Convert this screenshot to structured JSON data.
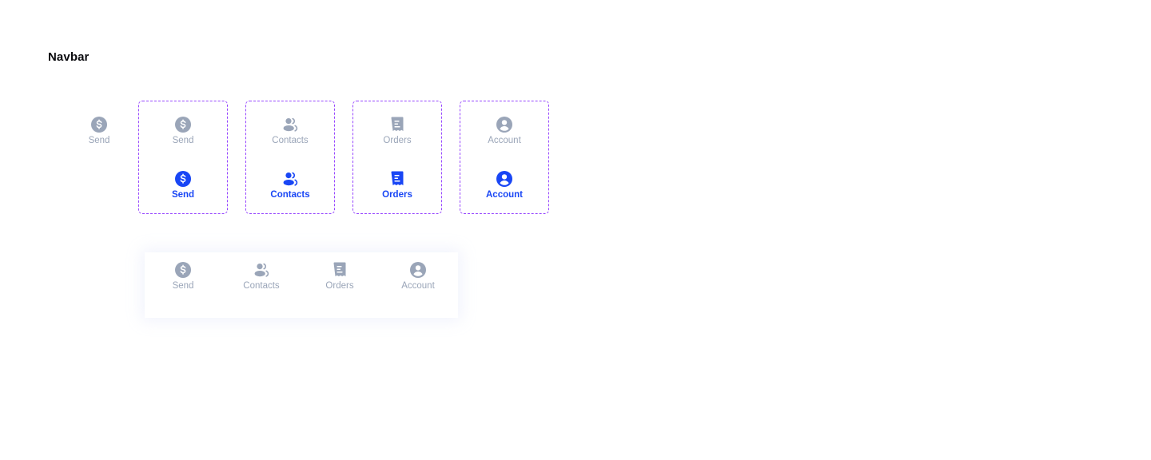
{
  "page": {
    "title": "Navbar"
  },
  "colors": {
    "inactive": "#9aa5b8",
    "active": "#1946f5",
    "variant_border": "#9747ff"
  },
  "standalone_item": {
    "label": "Send",
    "icon": "dollar-circle-icon",
    "state": "inactive"
  },
  "variants": [
    {
      "name": "send",
      "icon": "dollar-circle-icon",
      "inactive_label": "Send",
      "active_label": "Send"
    },
    {
      "name": "contacts",
      "icon": "contacts-icon",
      "inactive_label": "Contacts",
      "active_label": "Contacts"
    },
    {
      "name": "orders",
      "icon": "receipt-icon",
      "inactive_label": "Orders",
      "active_label": "Orders"
    },
    {
      "name": "account",
      "icon": "account-circle-icon",
      "inactive_label": "Account",
      "active_label": "Account"
    }
  ],
  "navbar": {
    "items": [
      {
        "label": "Send",
        "icon": "dollar-circle-icon",
        "state": "inactive"
      },
      {
        "label": "Contacts",
        "icon": "contacts-icon",
        "state": "inactive"
      },
      {
        "label": "Orders",
        "icon": "receipt-icon",
        "state": "inactive"
      },
      {
        "label": "Account",
        "icon": "account-circle-icon",
        "state": "inactive"
      }
    ]
  }
}
